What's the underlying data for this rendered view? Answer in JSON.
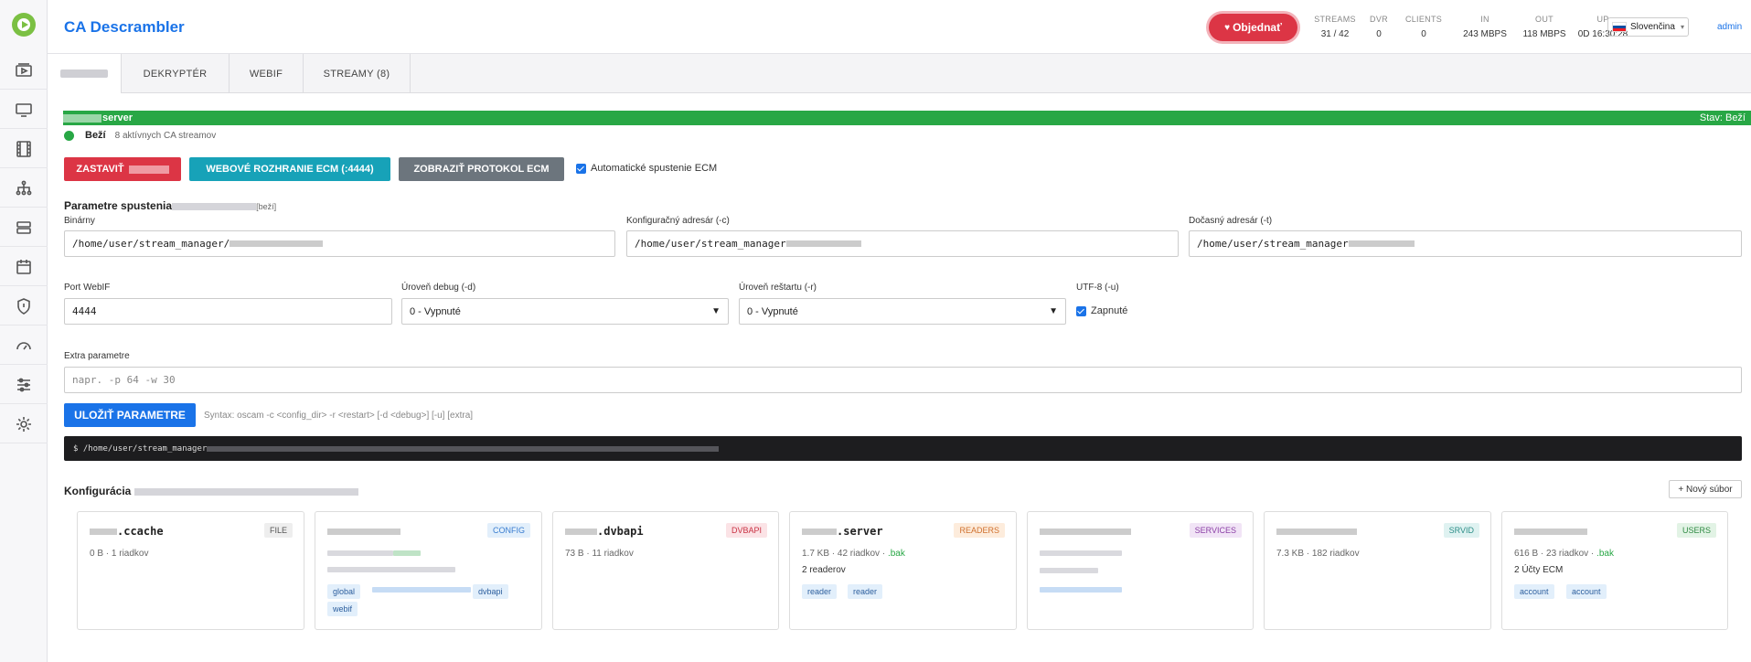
{
  "app": {
    "title": "CA Descrambler"
  },
  "header": {
    "order_label": "Objednať",
    "stats": [
      {
        "label": "STREAMS",
        "value": "31 / 42"
      },
      {
        "label": "DVR",
        "value": "0"
      },
      {
        "label": "CLIENTS",
        "value": "0"
      },
      {
        "label": "IN",
        "value": "243 MBPS"
      },
      {
        "label": "OUT",
        "value": "118 MBPS"
      },
      {
        "label": "UP",
        "value": "0D 16:30:28"
      }
    ],
    "language": "Slovenčina",
    "user": "admin"
  },
  "tabs": [
    {
      "label": ""
    },
    {
      "label": "DEKRYPTÉR"
    },
    {
      "label": "WEBIF"
    },
    {
      "label": "STREAMY (8)"
    }
  ],
  "server": {
    "name_suffix": "server",
    "state": "Stav: Beží",
    "status": "Beží",
    "streams": "8 aktívnych CA streamov"
  },
  "actions": {
    "stop": "ZASTAVIŤ",
    "webif": "WEBOVÉ ROZHRANIE ECM (:4444)",
    "log": "ZOBRAZIŤ PROTOKOL ECM",
    "autostart": "Automatické spustenie ECM"
  },
  "params": {
    "title": "Parametre spustenia",
    "state_tag": "[beží]",
    "binary_label": "Binárny",
    "binary_value": "/home/user/stream_manager/",
    "config_label": "Konfiguračný adresár (-c)",
    "config_value": "/home/user/stream_manager",
    "temp_label": "Dočasný adresár (-t)",
    "temp_value": "/home/user/stream_manager",
    "port_label": "Port WebIF",
    "port_value": "4444",
    "debug_label": "Úroveň debug (-d)",
    "debug_value": "0 - Vypnuté",
    "restart_label": "Úroveň reštartu (-r)",
    "restart_value": "0 - Vypnuté",
    "utf_label": "UTF-8 (-u)",
    "utf_value": "Zapnuté",
    "extra_label": "Extra parametre",
    "extra_placeholder": "napr. -p 64 -w 30",
    "save": "ULOŽIŤ PARAMETRE",
    "syntax": "Syntax: oscam -c <config_dir> -r <restart> [-d <debug>] [-u] [extra]",
    "command": "$ /home/user/stream_manager"
  },
  "config": {
    "title": "Konfigurácia",
    "new_file": "+ Nový súbor",
    "cards": [
      {
        "name": ".ccache",
        "badge": "FILE",
        "meta": "0 B · 1 riadkov",
        "bak": "",
        "sub": "",
        "chips": []
      },
      {
        "name": "",
        "badge": "CONFIG",
        "meta": "",
        "bak": "",
        "sub": "",
        "chips": [
          "global",
          "dvbapi",
          "webif"
        ]
      },
      {
        "name": ".dvbapi",
        "badge": "DVBAPI",
        "meta": "73 B · 11 riadkov",
        "bak": "",
        "sub": "",
        "chips": []
      },
      {
        "name": ".server",
        "badge": "READERS",
        "meta": "1.7 KB · 42 riadkov · ",
        "bak": ".bak",
        "sub": "2 readerov",
        "chips": [
          "reader",
          "reader"
        ]
      },
      {
        "name": "",
        "badge": "SERVICES",
        "meta": "",
        "bak": "",
        "sub": "",
        "chips": []
      },
      {
        "name": "",
        "badge": "SRVID",
        "meta": "7.3 KB · 182 riadkov",
        "bak": "",
        "sub": "",
        "chips": []
      },
      {
        "name": "",
        "badge": "USERS",
        "meta": "616 B · 23 riadkov · ",
        "bak": ".bak",
        "sub": "2 Účty ECM",
        "chips": [
          "account",
          "account"
        ]
      }
    ]
  },
  "colors": {
    "accent": "#1a73e8",
    "success": "#28a745",
    "danger": "#dc3545",
    "info": "#17a2b8"
  }
}
